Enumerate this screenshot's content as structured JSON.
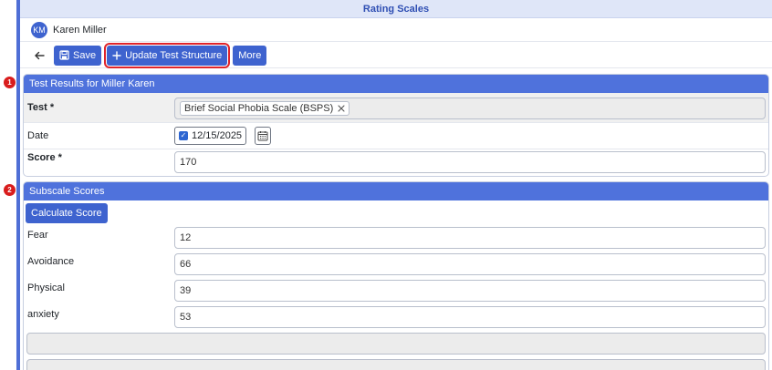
{
  "window": {
    "title": "Rating Scales"
  },
  "user": {
    "initials": "KM",
    "name": "Karen Miller"
  },
  "toolbar": {
    "back_icon": "arrow-left-icon",
    "save_label": "Save",
    "update_label": "Update Test Structure",
    "more_label": "More"
  },
  "test_results": {
    "badge": "1",
    "header": "Test Results for Miller Karen",
    "test_label": "Test *",
    "test_value": "Brief Social Phobia Scale (BSPS)",
    "date_label": "Date",
    "date_value": "12/15/2025",
    "score_label": "Score *",
    "score_value": "170"
  },
  "subscales": {
    "badge": "2",
    "header": "Subscale Scores",
    "calculate_label": "Calculate Score",
    "rows": [
      {
        "label": "Fear",
        "value": "12"
      },
      {
        "label": "Avoidance",
        "value": "66"
      },
      {
        "label": "Physical",
        "value": "39"
      },
      {
        "label": "anxiety",
        "value": "53"
      }
    ]
  },
  "colors": {
    "accent": "#3e63cf",
    "header": "#4f72dc",
    "badge": "#d91d1d",
    "focus_outline": "#e0242b"
  }
}
